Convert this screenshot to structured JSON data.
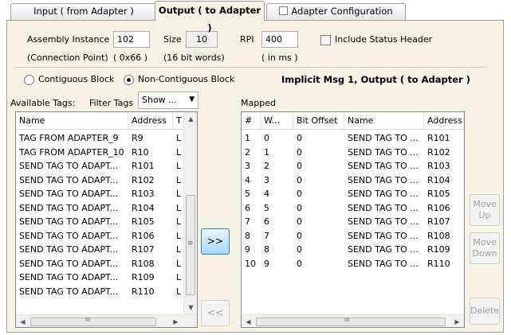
{
  "tabs": [
    {
      "label": "Input ( from Adapter )"
    },
    {
      "label": "Output ( to Adapter )"
    },
    {
      "label": "Adapter Configuration Data"
    }
  ],
  "assembly": {
    "label": "Assembly Instance",
    "value": "102",
    "sublabel": "(Connection Point)",
    "hex": "( 0x66 )"
  },
  "size": {
    "label": "Size",
    "value": "10",
    "unit": "(16 bit words)"
  },
  "rpi": {
    "label": "RPI",
    "value": "400",
    "unit": "( in ms )"
  },
  "include_status_header": {
    "label": "Include Status Header",
    "checked": false
  },
  "block_mode": {
    "options": [
      "Contiguous Block",
      "Non-Contiguous Block"
    ],
    "selected": "Non-Contiguous Block"
  },
  "message_title": "Implicit Msg 1, Output ( to Adapter )",
  "available": {
    "label": "Available Tags:",
    "filter_label": "Filter Tags",
    "filter_value": "Show ...",
    "columns": [
      "Name",
      "Address",
      "T"
    ],
    "rows": [
      [
        "TAG FROM ADAPTER_9",
        "R9",
        "L"
      ],
      [
        "TAG FROM ADAPTER_10",
        "R10",
        "L"
      ],
      [
        "SEND TAG TO ADAPT...",
        "R101",
        "L"
      ],
      [
        "SEND TAG TO ADAPT...",
        "R102",
        "L"
      ],
      [
        "SEND TAG TO ADAPT...",
        "R103",
        "L"
      ],
      [
        "SEND TAG TO ADAPT...",
        "R104",
        "L"
      ],
      [
        "SEND TAG TO ADAPT...",
        "R105",
        "L"
      ],
      [
        "SEND TAG TO ADAPT...",
        "R106",
        "L"
      ],
      [
        "SEND TAG TO ADAPT...",
        "R107",
        "L"
      ],
      [
        "SEND TAG TO ADAPT...",
        "R108",
        "L"
      ],
      [
        "SEND TAG TO ADAPT...",
        "R109",
        "L"
      ],
      [
        "SEND TAG TO ADAPT...",
        "R110",
        "L"
      ]
    ]
  },
  "transfer": {
    "add": ">>",
    "remove": "<<"
  },
  "mapped": {
    "label": "Mapped",
    "columns": [
      "#",
      "W...",
      "Bit Offset",
      "Name",
      "Address"
    ],
    "rows": [
      [
        "1",
        "0",
        "0",
        "SEND TAG TO ...",
        "R101"
      ],
      [
        "2",
        "1",
        "0",
        "SEND TAG TO ...",
        "R102"
      ],
      [
        "3",
        "2",
        "0",
        "SEND TAG TO ...",
        "R103"
      ],
      [
        "4",
        "3",
        "0",
        "SEND TAG TO ...",
        "R104"
      ],
      [
        "5",
        "4",
        "0",
        "SEND TAG TO ...",
        "R105"
      ],
      [
        "6",
        "5",
        "0",
        "SEND TAG TO ...",
        "R106"
      ],
      [
        "7",
        "6",
        "0",
        "SEND TAG TO ...",
        "R107"
      ],
      [
        "8",
        "7",
        "0",
        "SEND TAG TO ...",
        "R108"
      ],
      [
        "9",
        "8",
        "0",
        "SEND TAG TO ...",
        "R109"
      ],
      [
        "10",
        "9",
        "0",
        "SEND TAG TO ...",
        "R110"
      ]
    ]
  },
  "side_buttons": {
    "move_up": "Move Up",
    "move_down": "Move Down",
    "delete": "Delete"
  },
  "scroll_glyphs": {
    "up": "▲",
    "down": "▼",
    "left": "◀",
    "right": "▶",
    "grip_v": "≡",
    "grip_h": "III",
    "dropdown": "▼"
  },
  "colors": {
    "panel": "#f6f2e4",
    "accent": "#a7d9f5"
  }
}
